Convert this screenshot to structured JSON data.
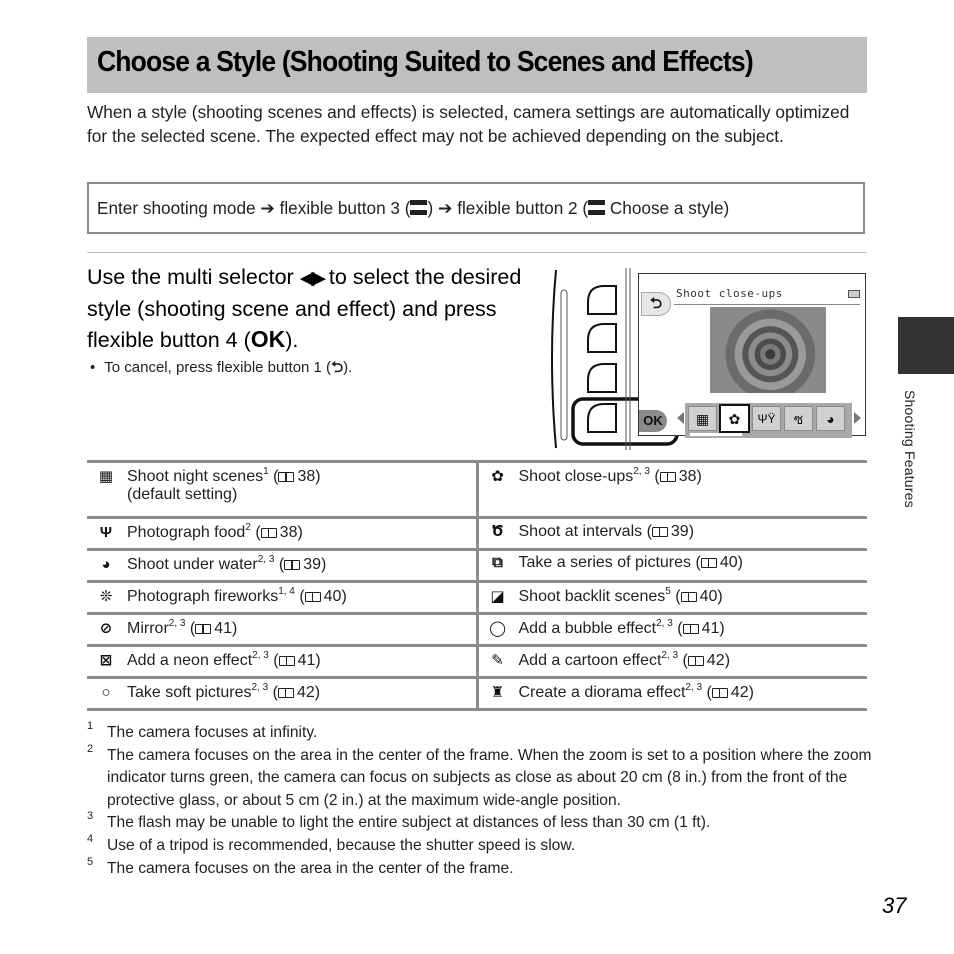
{
  "header": {
    "title": "Choose a Style (Shooting Suited to Scenes and Effects)"
  },
  "intro": "When a style (shooting scenes and effects) is selected, camera settings are automatically optimized for the selected scene. The expected effect may not be achieved depending on the subject.",
  "menu_path": {
    "part1": "Enter shooting mode",
    "arrow": "➔",
    "part2": "flexible button 3 (",
    "scene_icon_label": "SCENE",
    "part2_end": ")",
    "part3": "flexible button 2 (",
    "part3_end": " Choose a style)"
  },
  "step": {
    "text_before_arrows": "Use the multi selector ",
    "arrows_icon": "◀▶",
    "text_after_arrows": " to select the desired style (shooting scene and effect) and press flexible button 4 (",
    "ok_label": "OK",
    "text_end": ").",
    "bullet": "•",
    "bullet_text_before": "To cancel, press flexible button 1 (",
    "back_icon": "⮌",
    "bullet_text_after": ")."
  },
  "camera_screen": {
    "title": "Shoot close-ups",
    "back_icon": "⮌",
    "ok_label": "OK",
    "strip_icons": [
      {
        "name": "night-scene-icon",
        "glyph": "▦",
        "selected": false
      },
      {
        "name": "close-up-icon",
        "glyph": "✿",
        "selected": true
      },
      {
        "name": "food-icon",
        "glyph": "ΨΫ",
        "selected": false
      },
      {
        "name": "intervals-icon",
        "glyph": "ซ",
        "selected": false
      },
      {
        "name": "underwater-icon",
        "glyph": "◕",
        "selected": false
      }
    ]
  },
  "side_tab": {
    "label": "Shooting Features"
  },
  "table": {
    "rows": [
      {
        "left": {
          "icon": "night-scene-icon",
          "glyph": "▦",
          "label": "Shoot night scenes",
          "sup": "1",
          "page": "38",
          "note": "(default setting)"
        },
        "right": {
          "icon": "close-up-icon",
          "glyph": "✿",
          "label": "Shoot close-ups",
          "sup": "2, 3",
          "page": "38"
        }
      },
      {
        "left": {
          "icon": "food-icon",
          "glyph": "Ψ",
          "label": "Photograph food",
          "sup": "2",
          "page": "38"
        },
        "right": {
          "icon": "intervals-icon",
          "glyph": "Ծ",
          "label": "Shoot at intervals",
          "sup": "",
          "page": "39"
        }
      },
      {
        "left": {
          "icon": "underwater-icon",
          "glyph": "◕",
          "label": "Shoot under water",
          "sup": "2, 3",
          "page": "39"
        },
        "right": {
          "icon": "series-icon",
          "glyph": "⧉",
          "label": "Take a series of pictures",
          "sup": "",
          "page": "40"
        }
      },
      {
        "left": {
          "icon": "fireworks-icon",
          "glyph": "❊",
          "label": "Photograph fireworks",
          "sup": "1, 4",
          "page": "40"
        },
        "right": {
          "icon": "backlit-icon",
          "glyph": "◪",
          "label": "Shoot backlit scenes",
          "sup": "5",
          "page": "40"
        }
      },
      {
        "left": {
          "icon": "mirror-icon",
          "glyph": "⊘",
          "label": "Mirror",
          "sup": "2, 3",
          "page": "41"
        },
        "right": {
          "icon": "bubble-icon",
          "glyph": "◯",
          "label": "Add a bubble effect",
          "sup": "2, 3",
          "page": "41"
        }
      },
      {
        "left": {
          "icon": "neon-icon",
          "glyph": "⊠",
          "label": "Add a neon effect",
          "sup": "2, 3",
          "page": "41"
        },
        "right": {
          "icon": "cartoon-icon",
          "glyph": "✎",
          "label": "Add a cartoon effect",
          "sup": "2, 3",
          "page": "42"
        }
      },
      {
        "left": {
          "icon": "soft-icon",
          "glyph": "○",
          "label": "Take soft pictures",
          "sup": "2, 3",
          "page": "42"
        },
        "right": {
          "icon": "diorama-icon",
          "glyph": "♜",
          "label": "Create a diorama effect",
          "sup": "2, 3",
          "page": "42"
        }
      }
    ]
  },
  "footnotes": [
    {
      "num": "1",
      "text": "The camera focuses at infinity."
    },
    {
      "num": "2",
      "text": "The camera focuses on the area in the center of the frame. When the zoom is set to a position where the zoom indicator turns green, the camera can focus on subjects as close as about 20 cm (8 in.) from the front of the protective glass, or about 5 cm (2 in.) at the maximum wide-angle position."
    },
    {
      "num": "3",
      "text": "The flash may be unable to light the entire subject at distances of less than 30 cm (1 ft)."
    },
    {
      "num": "4",
      "text": "Use of a tripod is recommended, because the shutter speed is slow."
    },
    {
      "num": "5",
      "text": "The camera focuses on the area in the center of the frame."
    }
  ],
  "page_number": "37",
  "colors": {
    "title_bar": "#bfbfbf",
    "table_border": "#8c8c8c",
    "side_tab": "#333333"
  }
}
